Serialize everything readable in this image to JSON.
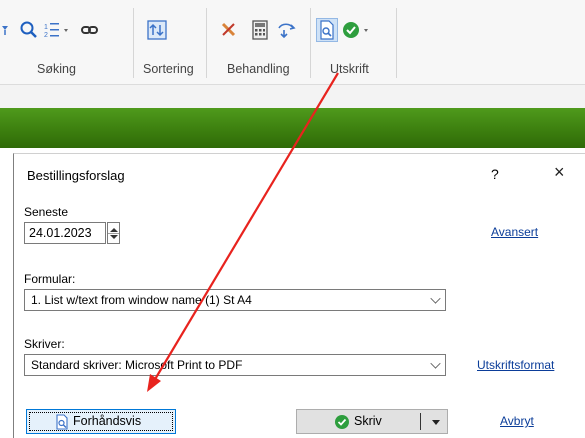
{
  "ribbon": {
    "groups": [
      {
        "label": "Søking"
      },
      {
        "label": "Sortering"
      },
      {
        "label": "Behandling"
      },
      {
        "label": "Utskrift"
      }
    ]
  },
  "dialog": {
    "title": "Bestillingsforslag",
    "help": "?",
    "close": "×",
    "seneste_label": "Seneste",
    "date_value": "24.01.2023",
    "avansert_link": "Avansert",
    "formular_label": "Formular:",
    "formular_value": "1. List w/text from window name (1) St A4",
    "skriver_label": "Skriver:",
    "skriver_value": "Standard skriver: Microsoft Print to PDF",
    "utskriftsformat_link": "Utskriftsformat",
    "preview_button": "Forhåndsvis",
    "write_button": "Skriv",
    "cancel_link": "Avbryt"
  },
  "colors": {
    "accent_green": "#3b7d0e",
    "annotation_red": "#e8231e",
    "link_blue": "#0b3d99",
    "ok_green": "#2e9e3e"
  }
}
